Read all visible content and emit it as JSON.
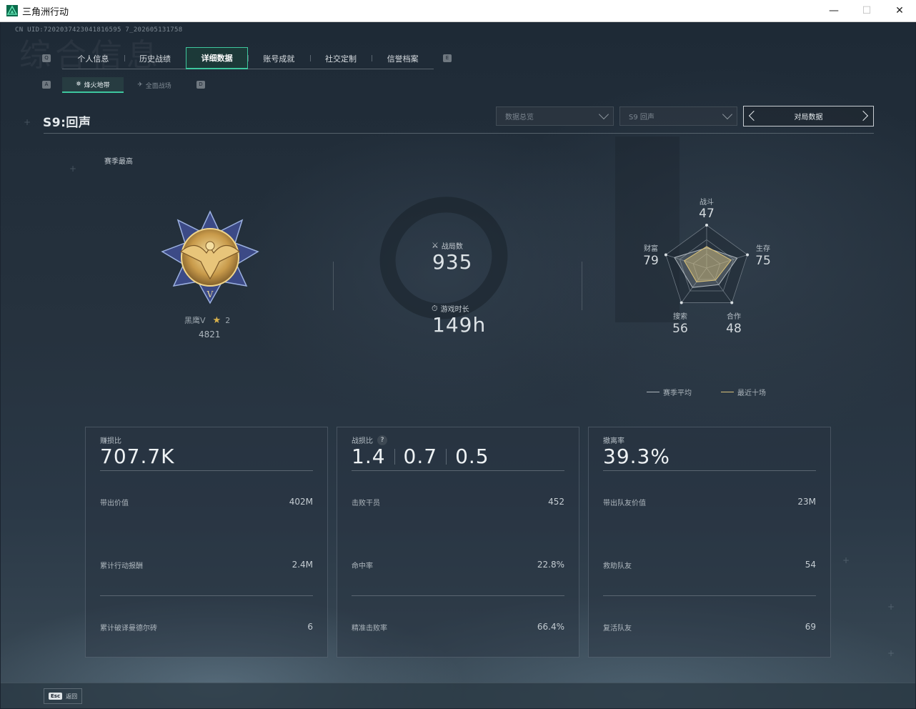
{
  "window": {
    "title": "三角洲行动",
    "minimize": "—",
    "maximize": "☐",
    "close": "✕"
  },
  "uid": "CN UID:7202037423041816595 7_202605131758",
  "watermark": "综合信息",
  "nav": {
    "left_key": "Q",
    "right_key": "E",
    "tabs": [
      {
        "label": "个人信息",
        "active": false
      },
      {
        "label": "历史战绩",
        "active": false
      },
      {
        "label": "详细数据",
        "active": true
      },
      {
        "label": "账号成就",
        "active": false
      },
      {
        "label": "社交定制",
        "active": false
      },
      {
        "label": "信誉档案",
        "active": false
      }
    ]
  },
  "subnav": {
    "left_key": "A",
    "right_key": "D",
    "tabs": [
      {
        "label": "烽火地带",
        "icon": "⛯",
        "active": true
      },
      {
        "label": "全面战场",
        "icon": "✈",
        "active": false
      }
    ]
  },
  "season": {
    "title": "S9:回声",
    "dropdown_1": "数据总览",
    "dropdown_2": "S9 回声",
    "pager_label": "对局数据"
  },
  "season_best": "赛季最高",
  "rank": {
    "name": "黑鹰V",
    "stars": "2",
    "score": "4821"
  },
  "stats": {
    "matches_label": "战局数",
    "matches_value": "935",
    "playtime_label": "游戏时长",
    "playtime_value": "149h"
  },
  "radar": {
    "axes": [
      {
        "label": "战斗",
        "value": "47"
      },
      {
        "label": "生存",
        "value": "75"
      },
      {
        "label": "合作",
        "value": "48"
      },
      {
        "label": "搜索",
        "value": "56"
      },
      {
        "label": "财富",
        "value": "79"
      }
    ],
    "season_avg": [
      0.47,
      0.75,
      0.48,
      0.56,
      0.79
    ],
    "recent_ten": [
      0.5,
      0.6,
      0.35,
      0.4,
      0.55
    ],
    "legend_avg": "赛季平均",
    "legend_recent": "最近十场",
    "color_avg": "#aeb6bd",
    "color_recent": "#d9c27a"
  },
  "cards": [
    {
      "header": "赚损比",
      "value": "707.7K",
      "rows": [
        {
          "label": "带出价值",
          "value": "402M"
        },
        {
          "label": "累计行动报酬",
          "value": "2.4M"
        },
        {
          "label": "累计破译曼德尔砖",
          "value": "6"
        }
      ]
    },
    {
      "header": "战损比",
      "help": "?",
      "values": [
        "1.4",
        "0.7",
        "0.5"
      ],
      "rows": [
        {
          "label": "击败干员",
          "value": "452"
        },
        {
          "label": "命中率",
          "value": "22.8%"
        },
        {
          "label": "精准击败率",
          "value": "66.4%"
        }
      ]
    },
    {
      "header": "撤离率",
      "value": "39.3%",
      "rows": [
        {
          "label": "带出队友价值",
          "value": "23M"
        },
        {
          "label": "救助队友",
          "value": "54"
        },
        {
          "label": "复活队友",
          "value": "69"
        }
      ]
    }
  ],
  "footer": {
    "esc_key": "Esc",
    "back_label": "返回"
  },
  "colors": {
    "accent": "#3ec79e",
    "star": "#d9b24c"
  }
}
